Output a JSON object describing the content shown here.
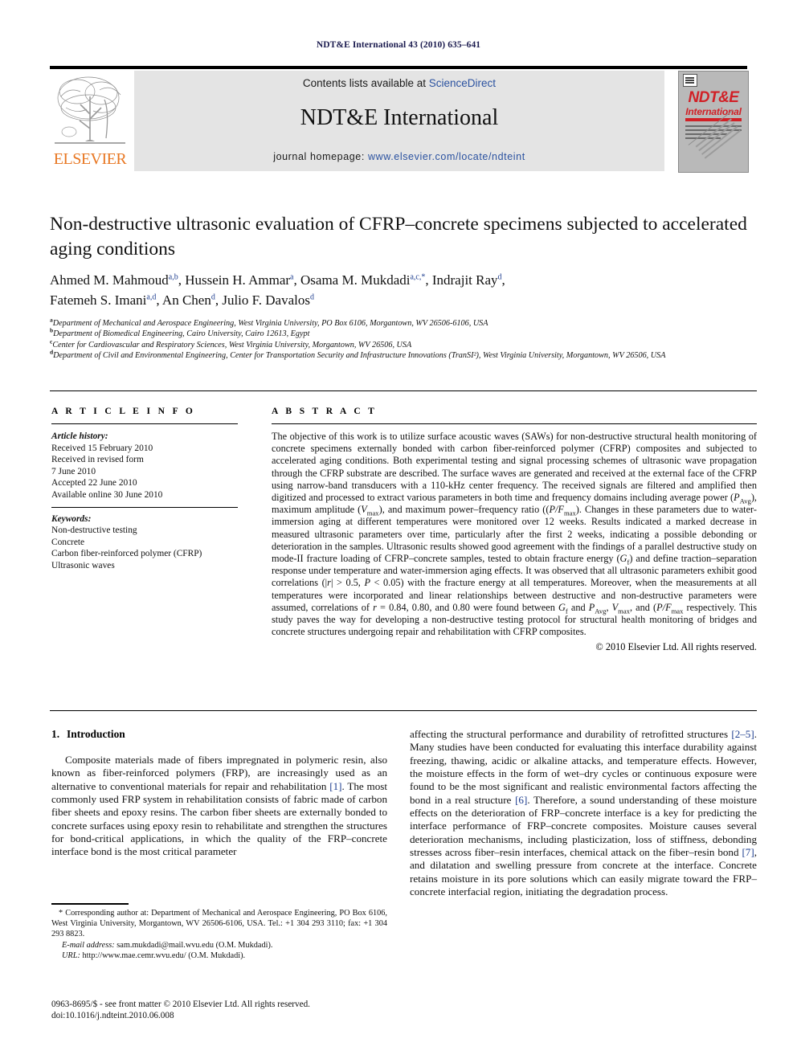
{
  "running_head": "NDT&E International 43 (2010) 635–641",
  "masthead": {
    "contents_prefix": "Contents lists available at",
    "sciencedirect": "ScienceDirect",
    "journal_name": "NDT&E International",
    "homepage_prefix": "journal homepage:",
    "homepage_url": "www.elsevier.com/locate/ndteint",
    "publisher_name": "ELSEVIER",
    "cover_title": "NDT&E",
    "cover_subtitle": "International",
    "accent_red": "#d12026",
    "accent_orange": "#E87722",
    "link_blue": "#2b52a0",
    "band_grey": "#e4e4e4"
  },
  "article": {
    "title": "Non-destructive ultrasonic evaluation of CFRP–concrete specimens subjected to accelerated aging conditions",
    "authors_line1": "Ahmed M. Mahmoud",
    "authors": [
      {
        "name": "Ahmed M. Mahmoud",
        "sup": "a,b"
      },
      {
        "name": "Hussein H. Ammar",
        "sup": "a"
      },
      {
        "name": "Osama M. Mukdadi",
        "sup": "a,c,*"
      },
      {
        "name": "Indrajit Ray",
        "sup": "d"
      },
      {
        "name": "Fatemeh S. Imani",
        "sup": "a,d"
      },
      {
        "name": "An Chen",
        "sup": "d"
      },
      {
        "name": "Julio F. Davalos",
        "sup": "d"
      }
    ],
    "affiliations": [
      {
        "label": "a",
        "text": "Department of Mechanical and Aerospace Engineering, West Virginia University, PO Box 6106, Morgantown, WV 26506-6106, USA"
      },
      {
        "label": "b",
        "text": "Department of Biomedical Engineering, Cairo University, Cairo 12613, Egypt"
      },
      {
        "label": "c",
        "text": "Center for Cardiovascular and Respiratory Sciences, West Virginia University, Morgantown, WV 26506, USA"
      },
      {
        "label": "d",
        "text": "Department of Civil and Environmental Engineering, Center for Transportation Security and Infrastructure Innovations (TranSI²), West Virginia University, Morgantown, WV 26506, USA"
      }
    ]
  },
  "article_info": {
    "heading": "A R T I C L E  I N F O",
    "history_label": "Article history:",
    "history": [
      "Received 15 February 2010",
      "Received in revised form",
      "7 June 2010",
      "Accepted 22 June 2010",
      "Available online 30 June 2010"
    ],
    "keywords_label": "Keywords:",
    "keywords": [
      "Non-destructive testing",
      "Concrete",
      "Carbon fiber-reinforced polymer (CFRP)",
      "Ultrasonic waves"
    ]
  },
  "abstract": {
    "heading": "A B S T R A C T",
    "part1": "The objective of this work is to utilize surface acoustic waves (SAWs) for non-destructive structural health monitoring of concrete specimens externally bonded with carbon fiber-reinforced polymer (CFRP) composites and subjected to accelerated aging conditions. Both experimental testing and signal processing schemes of ultrasonic wave propagation through the CFRP substrate are described. The surface waves are generated and received at the external face of the CFRP using narrow-band transducers with a 110-kHz center frequency. The received signals are filtered and amplified then digitized and processed to extract various parameters in both time and frequency domains including average power (",
    "sym_pavg": "P",
    "sub_avg": "Avg",
    "part2": "), maximum amplitude (",
    "sym_vmax": "V",
    "sub_max": "max",
    "part3": "), and maximum power–frequency ratio ((",
    "sym_pf": "P/F",
    "sub_max2": "max",
    "part4": "). Changes in these parameters due to water-immersion aging at different temperatures were monitored over 12 weeks. Results indicated a marked decrease in measured ultrasonic parameters over time, particularly after the first 2 weeks, indicating a possible debonding or deterioration in the samples. Ultrasonic results showed good agreement with the findings of a parallel destructive study on mode-II fracture loading of CFRP–concrete samples, tested to obtain fracture energy (",
    "sym_gf": "G",
    "sub_f": "f",
    "part5": ") and define traction–separation response under temperature and water-immersion aging effects. It was observed that all ultrasonic parameters exhibit good correlations (|",
    "sym_r": "r",
    "part6": "| > 0.5, ",
    "sym_p": "P",
    "part7": " < 0.05) with the fracture energy at all temperatures. Moreover, when the measurements at all temperatures were incorporated and linear relationships between destructive and non-destructive parameters were assumed, correlations of ",
    "sym_r2": "r",
    "part8": " = 0.84, 0.80, and 0.80 were found between ",
    "sym_gf2": "G",
    "sub_f2": "f",
    "part9": " and ",
    "sym_pavg2": "P",
    "sub_avg2": "Avg",
    "part10": ", ",
    "sym_vmax2": "V",
    "sub_max3": "max",
    "part11": ", and (",
    "sym_pf2": "P/F",
    "sub_max4": "max",
    "part12": " respectively. This study paves the way for developing a non-destructive testing protocol for structural health monitoring of bridges and concrete structures undergoing repair and rehabilitation with CFRP composites.",
    "copyright": "© 2010 Elsevier Ltd. All rights reserved."
  },
  "introduction": {
    "number": "1.",
    "heading": "Introduction",
    "left_p1_a": "Composite materials made of fibers impregnated in polymeric resin, also known as fiber-reinforced polymers (FRP), are increasingly used as an alternative to conventional materials for repair and rehabilitation ",
    "left_cite1": "[1]",
    "left_p1_b": ". The most commonly used FRP system in rehabilitation consists of fabric made of carbon fiber sheets and epoxy resins. The carbon fiber sheets are externally bonded to concrete surfaces using epoxy resin to rehabilitate and strengthen the structures for bond-critical applications, in which the quality of the FRP–concrete interface bond is the most critical parameter",
    "right_p1_a": "affecting the structural performance and durability of retrofitted structures ",
    "right_cite1": "[2–5]",
    "right_p1_b": ". Many studies have been conducted for evaluating this interface durability against freezing, thawing, acidic or alkaline attacks, and temperature effects. However, the moisture effects in the form of wet–dry cycles or continuous exposure were found to be the most significant and realistic environmental factors affecting the bond in a real structure ",
    "right_cite2": "[6]",
    "right_p1_c": ". Therefore, a sound understanding of these moisture effects on the deterioration of FRP–concrete interface is a key for predicting the interface performance of FRP–concrete composites. Moisture causes several deterioration mechanisms, including plasticization, loss of stiffness, debonding stresses across fiber–resin interfaces, chemical attack on the fiber–resin bond ",
    "right_cite3": "[7]",
    "right_p1_d": ", and dilatation and swelling pressure from concrete at the interface. Concrete retains moisture in its pore solutions which can easily migrate toward the FRP–concrete interfacial region, initiating the degradation process."
  },
  "footnotes": {
    "corresponding": "* Corresponding author at: Department of Mechanical and Aerospace Engineering, PO Box 6106, West Virginia University, Morgantown, WV 26506-6106, USA. Tel.: +1 304 293 3110; fax: +1 304 293 8823.",
    "email_label": "E-mail address:",
    "email_value": "sam.mukdadi@mail.wvu.edu (O.M. Mukdadi).",
    "url_label": "URL:",
    "url_value": "http://www.mae.cemr.wvu.edu/ (O.M. Mukdadi)."
  },
  "imprint": {
    "issn_line": "0963-8695/$ - see front matter © 2010 Elsevier Ltd. All rights reserved.",
    "doi_line": "doi:10.1016/j.ndteint.2010.06.008"
  }
}
